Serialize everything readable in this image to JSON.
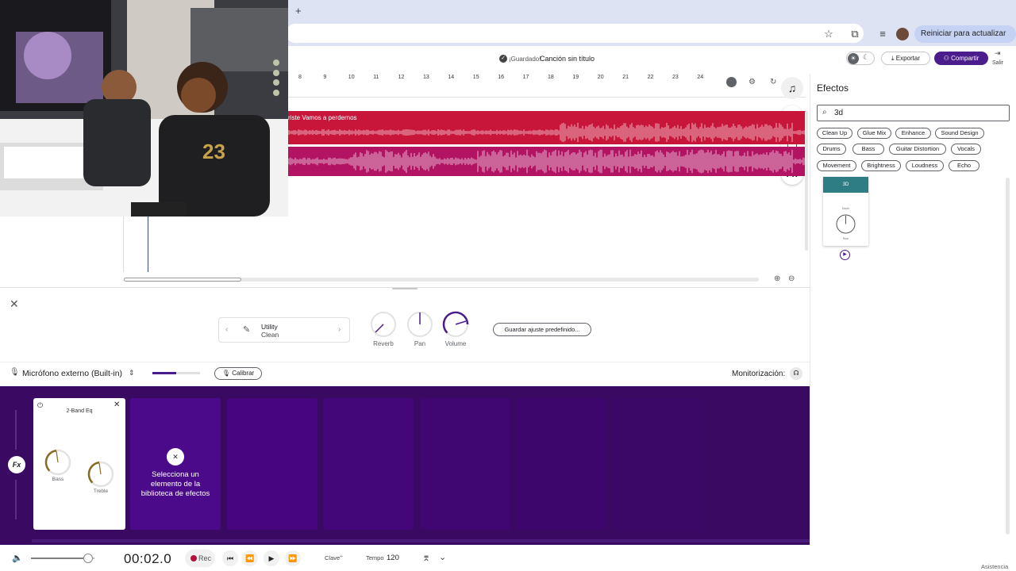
{
  "browser": {
    "new_tab_symbol": "+",
    "relaunch_label": "Reiniciar para actualizar"
  },
  "app": {
    "saved_status": "¡Guardado!",
    "song_title": "Canción sin título",
    "export_label": "Exportar",
    "share_label": "Compartir",
    "exit_label": "Salir"
  },
  "timeline": {
    "ruler_numbers": [
      "8",
      "9",
      "10",
      "11",
      "12",
      "13",
      "14",
      "15",
      "16",
      "17",
      "18",
      "19",
      "20",
      "21",
      "22",
      "23",
      "24"
    ],
    "track1_label": "riste Vamos a perdernos"
  },
  "effects_panel": {
    "title": "Efectos",
    "search_value": "3d",
    "chips": [
      "Clean Up",
      "Glue Mix",
      "Enhance",
      "Sound Design",
      "Drums",
      "Bass",
      "Guitar Distortion",
      "Vocals",
      "Movement",
      "Brightness",
      "Loudness",
      "Echo"
    ],
    "result_card": {
      "name": "3D",
      "knob_top": "Depth",
      "knob_bottom": "Rear"
    }
  },
  "instrument": {
    "preset_top": "Utility",
    "preset_bottom": "Clean",
    "reverb_label": "Reverb",
    "pan_label": "Pan",
    "volume_label": "Volume",
    "save_preset_label": "Guardar ajuste predefinido..."
  },
  "input": {
    "mic_label": "Micrófono externo (Built-in)",
    "calibrate_label": "Calibrar",
    "monitor_label": "Monitorización:",
    "input_level": 0.5
  },
  "fx_rack": {
    "fx_side_label": "Fx",
    "eq_card": {
      "title": "2-Band Eq",
      "bass_label": "Bass",
      "treble_label": "Treble"
    },
    "empty_message": "Selecciona un elemento de la biblioteca de efectos"
  },
  "transport": {
    "time": "00:02.0",
    "rec_label": "Rec",
    "key_label": "Clave",
    "tempo_label": "Tempo",
    "tempo_value": "120",
    "volume_level": 0.9,
    "assist_label": "Asistencia"
  },
  "colors": {
    "accent": "#4a1c8c",
    "track1": "#c8153a",
    "track2": "#b21463",
    "fx_rack": "#3a0a63",
    "effect_card_header": "#2e7d84"
  }
}
